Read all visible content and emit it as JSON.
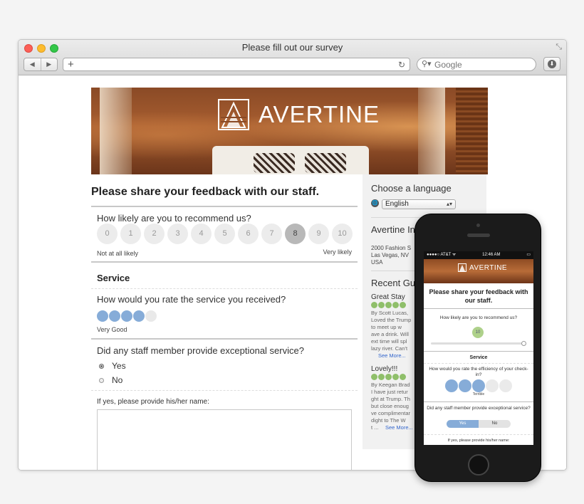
{
  "browser": {
    "title": "Please fill out our survey",
    "search_placeholder": "Google",
    "back_icon": "◀",
    "forward_icon": "▶",
    "new_tab_icon": "+",
    "reload_icon": "↻",
    "search_icon": "⚲▾",
    "download_icon": "⬇",
    "resize_icon": "⤡"
  },
  "brand": {
    "name": "AVERTINE"
  },
  "survey": {
    "heading": "Please share your feedback with our staff.",
    "nps": {
      "question": "How likely are you to recommend us?",
      "options": [
        "0",
        "1",
        "2",
        "3",
        "4",
        "5",
        "6",
        "7",
        "8",
        "9",
        "10"
      ],
      "selected": 8,
      "low_label": "Not at all likely",
      "high_label": "Very likely"
    },
    "service_section": "Service",
    "service_rating": {
      "question": "How would you rate the service you received?",
      "value": 4,
      "max": 5,
      "label": "Very Good"
    },
    "staff_question": "Did any staff member provide exceptional service?",
    "staff_options": [
      "Yes",
      "No"
    ],
    "staff_selected": "Yes",
    "name_prompt": "If yes, please provide his/her name:"
  },
  "sidebar": {
    "language_heading": "Choose a language",
    "language_value": "English",
    "language_icon": "🌐",
    "location_heading": "Avertine In",
    "address": "2000 Fashion S\nLas Vegas, NV\nUSA",
    "reviews_heading": "Recent Gu",
    "reviews": [
      {
        "title": "Great Stay",
        "body": "By Scott Lucas,\nLoved the Trump\nto meet up w\nave a drink. Will\next time will spl\nlazy river. Can't",
        "more": "See More..."
      },
      {
        "title": "Lovely!!!",
        "body": "By Keegan Brad\nI have just retur\nght at Trump. Th\nbut close enoug\nve complimentar\ndight to The W\nt ...",
        "more": "See More..."
      }
    ]
  },
  "mobile": {
    "status_carrier": "●●●●○ AT&T ᯤ",
    "status_time": "12:46 AM",
    "status_battery": "▭",
    "brand": "AVERTINE",
    "heading": "Please share your feedback with our staff.",
    "nps_question": "How likely are you to recommend us?",
    "nps_value": "10",
    "service_section": "Service",
    "rating_question": "How would you rate the efficiency of your check-in?",
    "rating_value": 3,
    "rating_label": "Terrible",
    "staff_question": "Did any staff member provide exceptional service?",
    "yes_label": "Yes",
    "no_label": "No",
    "name_prompt": "If yes, please provide his/her name:"
  }
}
